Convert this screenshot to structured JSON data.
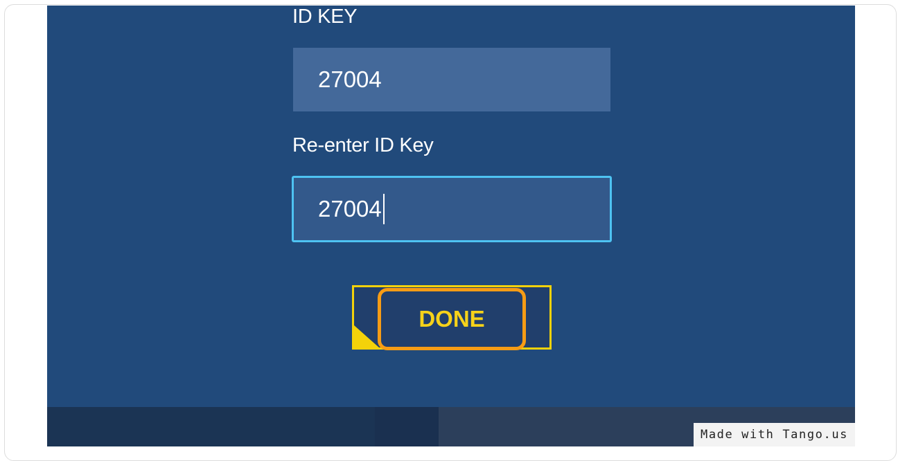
{
  "form": {
    "id_key_label": "ID KEY",
    "id_key_value": "27004",
    "reenter_label": "Re-enter ID Key",
    "reenter_value": "27004",
    "done_label": "DONE"
  },
  "watermark": "Made with Tango.us",
  "colors": {
    "background": "#214a7b",
    "focus_border": "#4ec3f2",
    "done_highlight": "#f79c15",
    "done_frame": "#f4d20a",
    "done_text": "#f6d21a"
  }
}
